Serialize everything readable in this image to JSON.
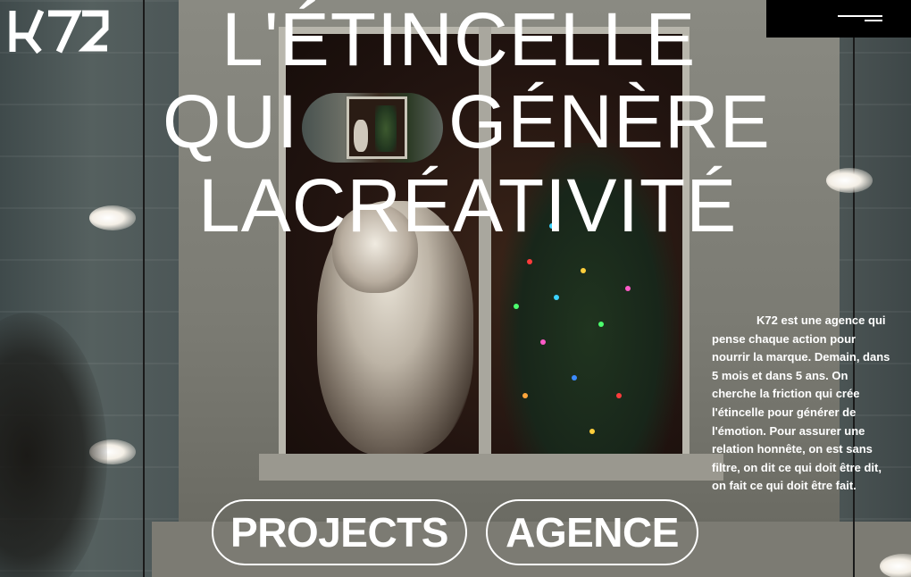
{
  "brand": {
    "logo_text": "K72"
  },
  "header": {
    "menu_icon": "hamburger-menu-icon"
  },
  "hero": {
    "line1": "L'ÉTINCELLE",
    "line2_left": "QUI",
    "line2_right": "GÉNÈRE",
    "line3": "LACRÉATIVITÉ"
  },
  "intro": {
    "text": "K72 est une agence qui pense chaque action pour nourrir la marque. Demain, dans 5 mois et dans 5 ans. On cherche la friction qui crée l'étincelle pour générer de l'émotion. Pour assurer une relation honnête, on est sans filtre, on dit ce qui doit être dit, on fait ce qui doit être fait."
  },
  "nav": {
    "projects_label": "PROJECTS",
    "agence_label": "AGENCE"
  },
  "colors": {
    "text": "#ffffff",
    "menu_bg": "#000000"
  }
}
